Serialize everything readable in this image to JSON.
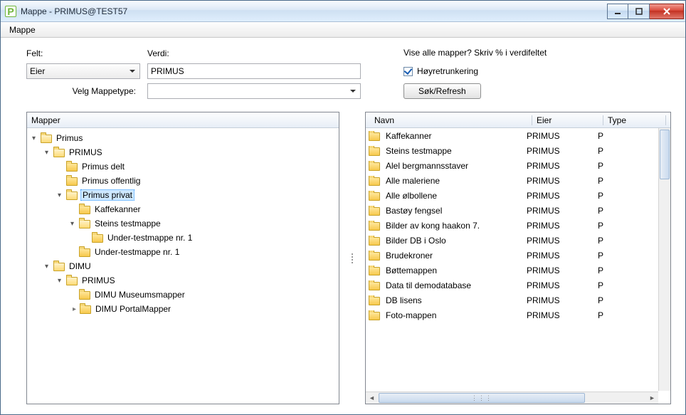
{
  "window": {
    "title": "Mappe - PRIMUS@TEST57"
  },
  "menu": {
    "mappe": "Mappe"
  },
  "search": {
    "felt_label": "Felt:",
    "felt_value": "Eier",
    "verdi_label": "Verdi:",
    "verdi_value": "PRIMUS",
    "hint": "Vise alle mapper? Skriv % i verdifeltet",
    "trunc_label": "Høyretrunkering",
    "trunc_checked": true,
    "type_label": "Velg Mappetype:",
    "type_value": "",
    "search_btn": "Søk/Refresh"
  },
  "left": {
    "header": "Mapper"
  },
  "tree": {
    "root": "Primus",
    "primus": "PRIMUS",
    "delt": "Primus delt",
    "offentlig": "Primus offentlig",
    "privat": "Primus privat",
    "kaffe": "Kaffekanner",
    "steins": "Steins testmappe",
    "under1": "Under-testmappe nr. 1",
    "under1b": "Under-testmappe nr. 1",
    "dimu": "DIMU",
    "dimu_primus": "PRIMUS",
    "dimu_museum": "DIMU Museumsmapper",
    "dimu_portal": "DIMU PortalMapper"
  },
  "right": {
    "cols": {
      "navn": "Navn",
      "eier": "Eier",
      "type": "Type"
    },
    "rows": [
      {
        "navn": "Kaffekanner",
        "eier": "PRIMUS",
        "type": "P"
      },
      {
        "navn": "Steins testmappe",
        "eier": "PRIMUS",
        "type": "P"
      },
      {
        "navn": "Alel bergmannsstaver",
        "eier": "PRIMUS",
        "type": "P"
      },
      {
        "navn": "Alle maleriene",
        "eier": "PRIMUS",
        "type": "P"
      },
      {
        "navn": "Alle ølbollene",
        "eier": "PRIMUS",
        "type": "P"
      },
      {
        "navn": "Bastøy fengsel",
        "eier": "PRIMUS",
        "type": "P"
      },
      {
        "navn": "Bilder av kong haakon 7.",
        "eier": "PRIMUS",
        "type": "P"
      },
      {
        "navn": "Bilder DB i Oslo",
        "eier": "PRIMUS",
        "type": "P"
      },
      {
        "navn": "Brudekroner",
        "eier": "PRIMUS",
        "type": "P"
      },
      {
        "navn": "Bøttemappen",
        "eier": "PRIMUS",
        "type": "P"
      },
      {
        "navn": "Data til demodatabase",
        "eier": "PRIMUS",
        "type": "P"
      },
      {
        "navn": "DB lisens",
        "eier": "PRIMUS",
        "type": "P"
      },
      {
        "navn": "Foto-mappen",
        "eier": "PRIMUS",
        "type": "P"
      }
    ]
  }
}
